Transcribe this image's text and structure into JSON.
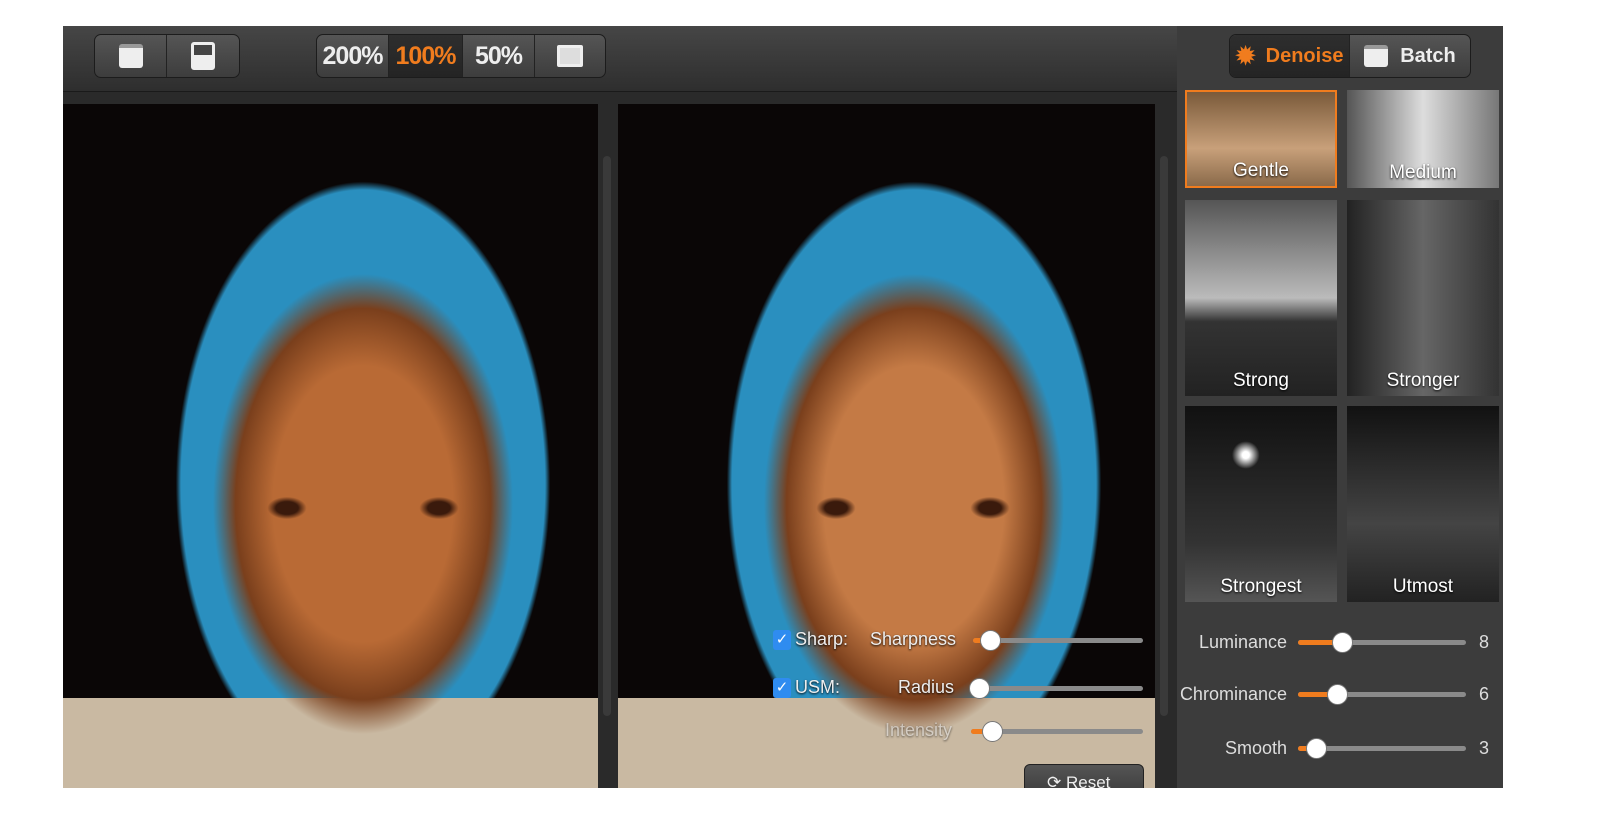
{
  "toolbar": {
    "open_icon": "folder-icon",
    "save_icon": "floppy-disk-icon",
    "zoom_options": [
      "200%",
      "100%",
      "50%"
    ],
    "zoom_selected": "100%",
    "fit_icon": "fit-screen-icon"
  },
  "mode_tabs": [
    {
      "label": "Denoise",
      "icon": "gear-icon",
      "active": true
    },
    {
      "label": "Batch",
      "icon": "folder-icon",
      "active": false
    }
  ],
  "presets": [
    "Gentle",
    "Medium",
    "Strong",
    "Stronger",
    "Strongest",
    "Utmost"
  ],
  "preset_selected": "Gentle",
  "sliders": [
    {
      "label": "Luminance",
      "value": "8",
      "position": 0.26
    },
    {
      "label": "Chrominance",
      "value": "6",
      "position": 0.23
    },
    {
      "label": "Smooth",
      "value": "3",
      "position": 0.11
    }
  ],
  "overlay": {
    "sharp": {
      "checkbox_label": "Sharp:",
      "checked": true,
      "slider_label": "Sharpness",
      "position": 0.1
    },
    "usm": {
      "checkbox_label": "USM:",
      "checked": true,
      "radius_label": "Radius",
      "radius_position": 0.06,
      "intensity_label": "Intensity",
      "intensity_position": 0.12
    },
    "reset_label": "Reset",
    "reset_icon": "refresh-icon"
  },
  "colors": {
    "accent": "#f07c1e",
    "checkbox": "#2f8cf0"
  }
}
